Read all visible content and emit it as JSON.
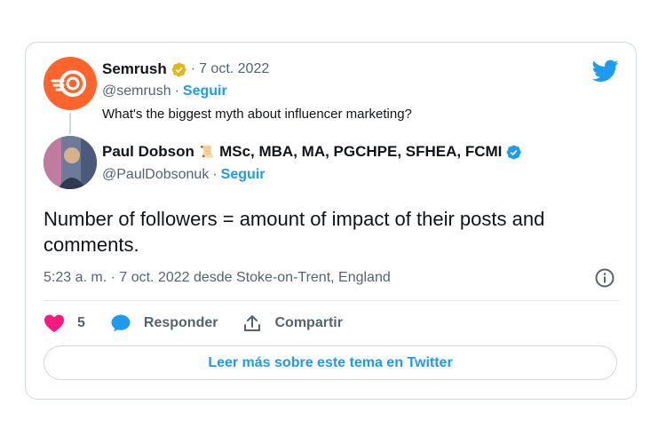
{
  "quoted_tweet": {
    "author_name": "Semrush",
    "date": "7 oct. 2022",
    "handle": "@semrush",
    "follow_label": "Seguir",
    "text": "What's the biggest myth about influencer marketing?"
  },
  "reply_tweet": {
    "author_name": "Paul Dobson",
    "author_credentials": "MSc, MBA, MA, PGCHPE, SFHEA, FCMI",
    "handle": "@PaulDobsonuk",
    "follow_label": "Seguir",
    "text": "Number of followers = amount of impact of their posts and comments.",
    "timestamp": "5:23 a. m. · 7 oct. 2022 desde Stoke-on-Trent, England"
  },
  "actions": {
    "like_count": "5",
    "reply_label": "Responder",
    "share_label": "Compartir"
  },
  "read_more_label": "Leer más sobre este tema en Twitter",
  "colors": {
    "twitter_blue": "#1d9bf0",
    "like_red": "#f91880",
    "semrush_orange": "#ff642d",
    "verified_gold": "#e2b719"
  },
  "icons": [
    "twitter-logo-icon",
    "verified-gold-icon",
    "verified-blue-icon",
    "info-icon",
    "heart-icon",
    "reply-icon",
    "share-icon"
  ]
}
